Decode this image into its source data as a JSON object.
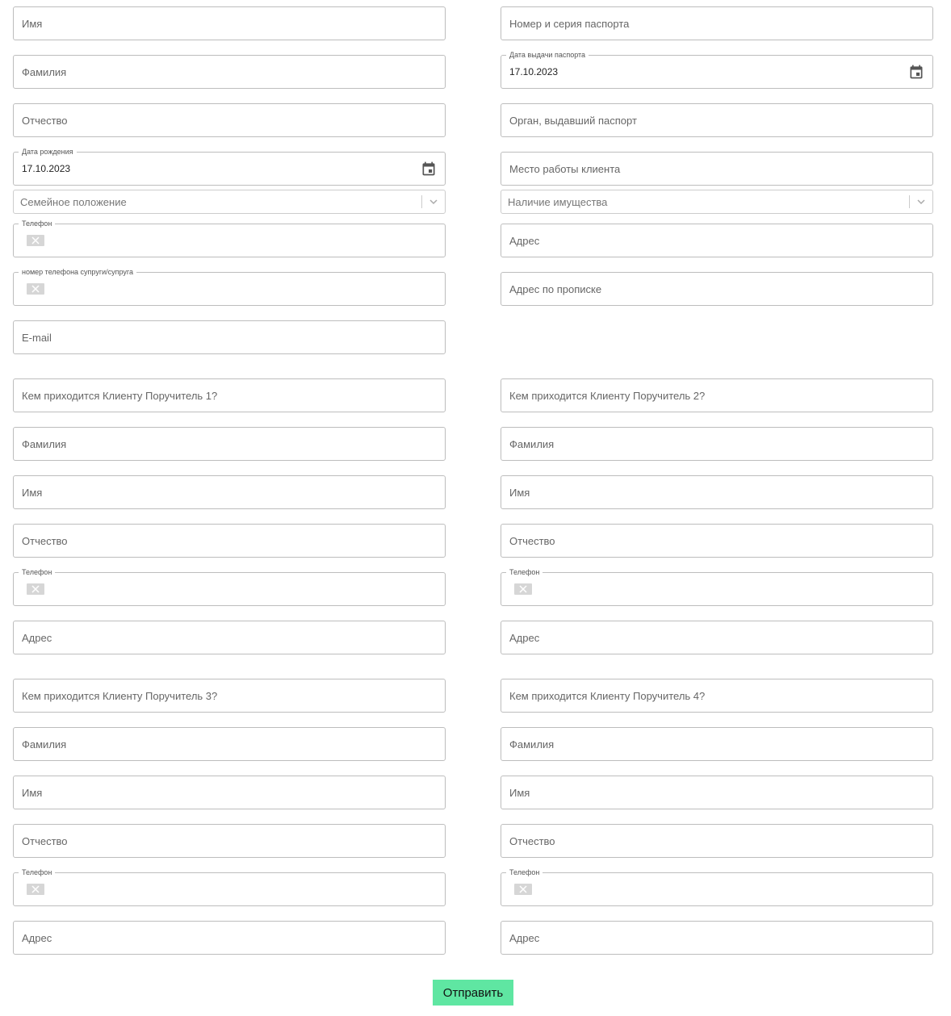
{
  "client": {
    "first_name": "Имя",
    "last_name": "Фамилия",
    "patronymic": "Отчество",
    "birth_date_label": "Дата рождения",
    "birth_date_value": "17.10.2023",
    "marital_status": "Семейное положение",
    "phone_label": "Телефон",
    "spouse_phone_label": "номер телефона супруги/супруга",
    "email": "E-mail",
    "passport_number": "Номер и серия паспорта",
    "passport_date_label": "Дата выдачи паспорта",
    "passport_date_value": "17.10.2023",
    "passport_issuer": "Орган, выдавший паспорт",
    "workplace": "Место работы клиента",
    "property": "Наличие имущества",
    "address": "Адрес",
    "registration_address": "Адрес по прописке"
  },
  "guarantors": [
    {
      "relation": "Кем приходится Клиенту Поручитель 1?",
      "last_name": "Фамилия",
      "first_name": "Имя",
      "patronymic": "Отчество",
      "phone_label": "Телефон",
      "address": "Адрес"
    },
    {
      "relation": "Кем приходится Клиенту Поручитель 2?",
      "last_name": "Фамилия",
      "first_name": "Имя",
      "patronymic": "Отчество",
      "phone_label": "Телефон",
      "address": "Адрес"
    },
    {
      "relation": "Кем приходится Клиенту Поручитель 3?",
      "last_name": "Фамилия",
      "first_name": "Имя",
      "patronymic": "Отчество",
      "phone_label": "Телефон",
      "address": "Адрес"
    },
    {
      "relation": "Кем приходится Клиенту Поручитель 4?",
      "last_name": "Фамилия",
      "first_name": "Имя",
      "patronymic": "Отчество",
      "phone_label": "Телефон",
      "address": "Адрес"
    }
  ],
  "submit_label": "Отправить",
  "icons": {
    "date": "calendar-icon",
    "phone_country": "flag-icon",
    "select": "chevron-down-icon"
  },
  "colors": {
    "submit_bg": "#5fe6a2",
    "border": "#bdbdbd"
  }
}
